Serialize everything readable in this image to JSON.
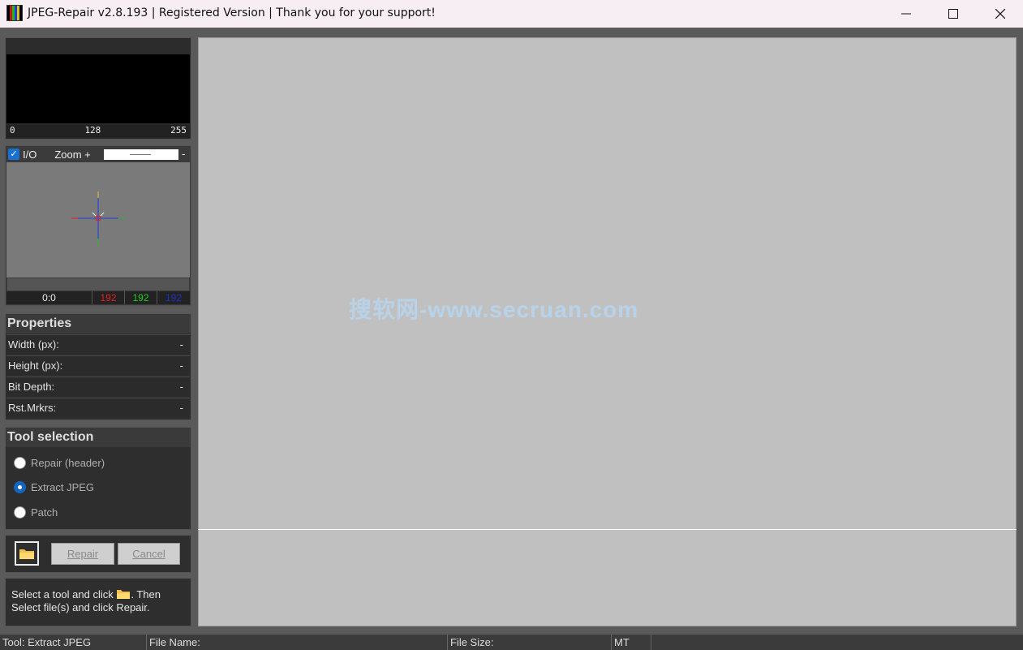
{
  "window": {
    "title": "JPEG-Repair v2.8.193 | Registered Version | Thank you for your support!",
    "minimize_icon": "minimize-icon",
    "maximize_icon": "maximize-icon",
    "close_icon": "close-icon"
  },
  "histogram": {
    "axis": [
      "0",
      "128",
      "255"
    ]
  },
  "loupe": {
    "io_label": "I/O",
    "io_checked": true,
    "zoom_label": "Zoom +",
    "zoom_minus": "-",
    "coords": "0:0",
    "r": "192",
    "g": "192",
    "b": "192",
    "colors": {
      "r": "#e02020",
      "g": "#20d020",
      "b": "#2030d0"
    }
  },
  "properties": {
    "title": "Properties",
    "rows": [
      {
        "label": "Width (px):",
        "value": "-"
      },
      {
        "label": "Height (px):",
        "value": "-"
      },
      {
        "label": "Bit Depth:",
        "value": "-"
      },
      {
        "label": "Rst.Mrkrs:",
        "value": "-"
      }
    ]
  },
  "tools": {
    "title": "Tool selection",
    "options": [
      {
        "label": "Repair (header)",
        "selected": false
      },
      {
        "label": "Extract JPEG",
        "selected": true
      },
      {
        "label": "Patch",
        "selected": false
      }
    ]
  },
  "actions": {
    "open_icon": "folder-icon",
    "repair_label": "Repair",
    "cancel_label": "Cancel"
  },
  "hint": {
    "line1a": "Select a tool and click",
    "line1b": ". Then",
    "line2": "Select file(s) and click Repair."
  },
  "watermark": "搜软网-www.secruan.com",
  "statusbar": {
    "tool": "Tool: Extract JPEG",
    "file_name": "File Name:",
    "file_size": "File Size:",
    "mode": "MT"
  }
}
